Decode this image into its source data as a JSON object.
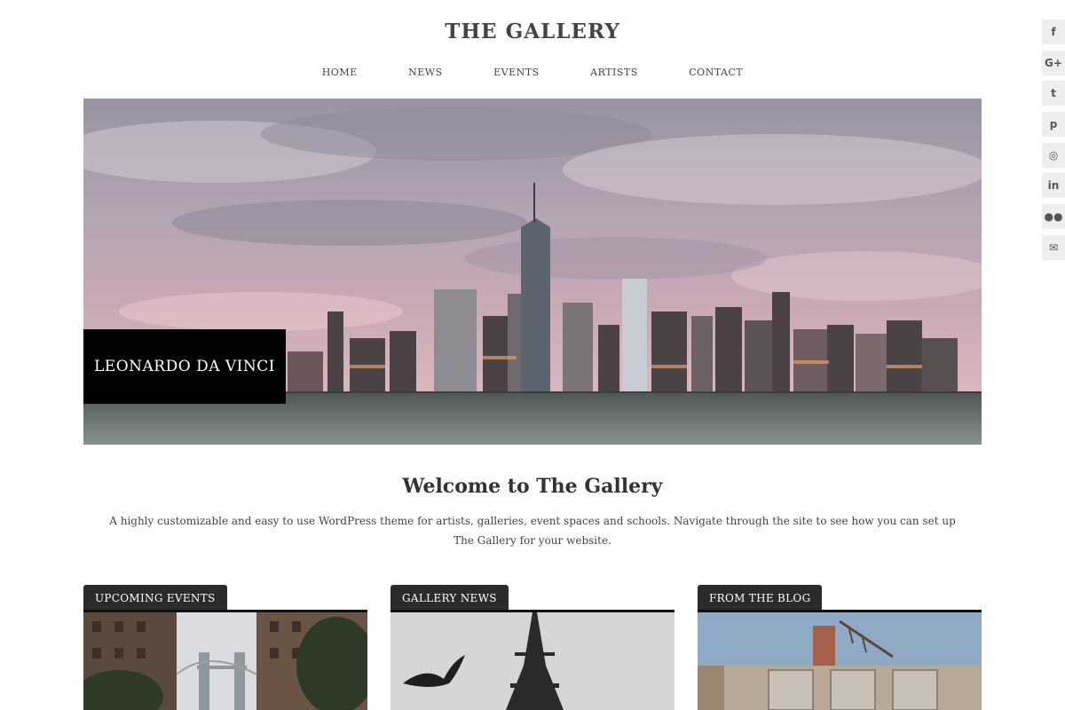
{
  "site": {
    "title": "THE GALLERY"
  },
  "nav": {
    "items": [
      {
        "label": "HOME"
      },
      {
        "label": "NEWS"
      },
      {
        "label": "EVENTS"
      },
      {
        "label": "ARTISTS"
      },
      {
        "label": "CONTACT"
      }
    ]
  },
  "hero": {
    "caption": "LEONARDO DA VINCI"
  },
  "welcome": {
    "title": "Welcome to The Gallery",
    "text": "A highly customizable and easy to use WordPress theme for artists, galleries, event spaces and schools. Navigate through the site to see how you can set up The Gallery for your website."
  },
  "sections": [
    {
      "label": "UPCOMING EVENTS"
    },
    {
      "label": "GALLERY NEWS"
    },
    {
      "label": "FROM THE BLOG"
    }
  ],
  "social": {
    "icons": [
      {
        "name": "facebook-icon",
        "glyph": "f"
      },
      {
        "name": "google-plus-icon",
        "glyph": "G+"
      },
      {
        "name": "twitter-icon",
        "glyph": "t"
      },
      {
        "name": "pinterest-icon",
        "glyph": "p"
      },
      {
        "name": "instagram-icon",
        "glyph": "◎"
      },
      {
        "name": "linkedin-icon",
        "glyph": "in"
      },
      {
        "name": "flickr-icon",
        "glyph": "●●"
      },
      {
        "name": "email-icon",
        "glyph": "✉"
      }
    ]
  },
  "colors": {
    "tab_background": "#2b2b2b",
    "caption_background": "#000000",
    "social_background": "#eeeeee"
  }
}
